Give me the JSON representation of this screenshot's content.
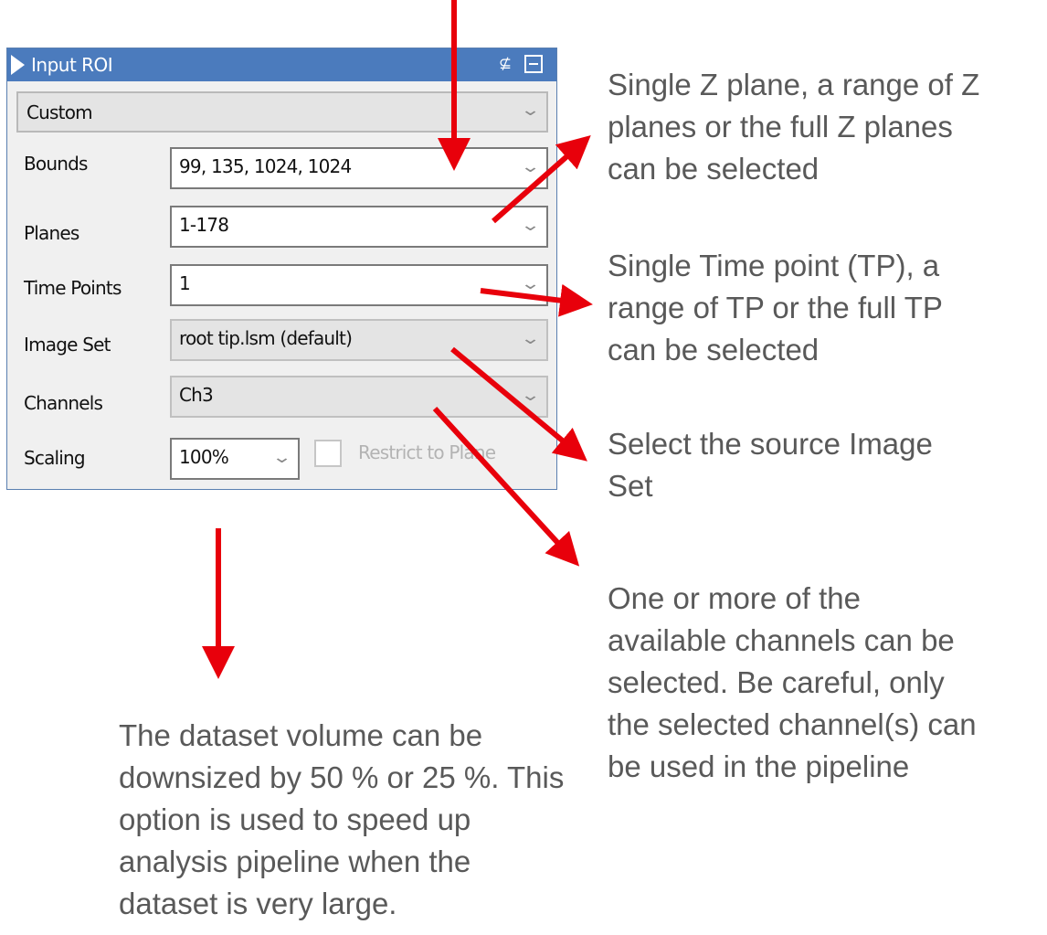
{
  "panel": {
    "title": "Input ROI",
    "preset": "Custom",
    "rows": [
      {
        "label": "Bounds",
        "value": "99, 135, 1024, 1024"
      },
      {
        "label": "Planes",
        "value": "1-178"
      },
      {
        "label": "Time Points",
        "value": "1"
      },
      {
        "label": "Image Set",
        "value": "root tip.lsm (default)"
      },
      {
        "label": "Channels",
        "value": "Ch3"
      }
    ],
    "scaling": {
      "label": "Scaling",
      "value": "100%"
    },
    "restrict": {
      "label": "Restrict to Plane",
      "checked": false
    }
  },
  "notes": {
    "planes": "Single Z plane, a range of Z\nplanes or the full Z planes\ncan be selected",
    "timepoints": "Single Time point (TP), a\nrange of TP or the full TP\ncan be selected",
    "imageset": "Select the source Image\nSet",
    "channels": "One or more of the\navailable channels can be\nselected. Be careful, only\nthe selected channel(s) can\nbe used in the pipeline",
    "scaling": "The dataset volume can be\ndownsized by 50 % or 25 %. This\noption is used to speed up\nanalysis pipeline when the\ndataset is very large."
  },
  "colors": {
    "titlebar": "#4b7bbd",
    "arrow": "#e8000b",
    "note_text": "#595959"
  },
  "icons": [
    "collapse-triangle-icon",
    "pin-icon",
    "maximize-icon",
    "chevron-down-icon"
  ]
}
